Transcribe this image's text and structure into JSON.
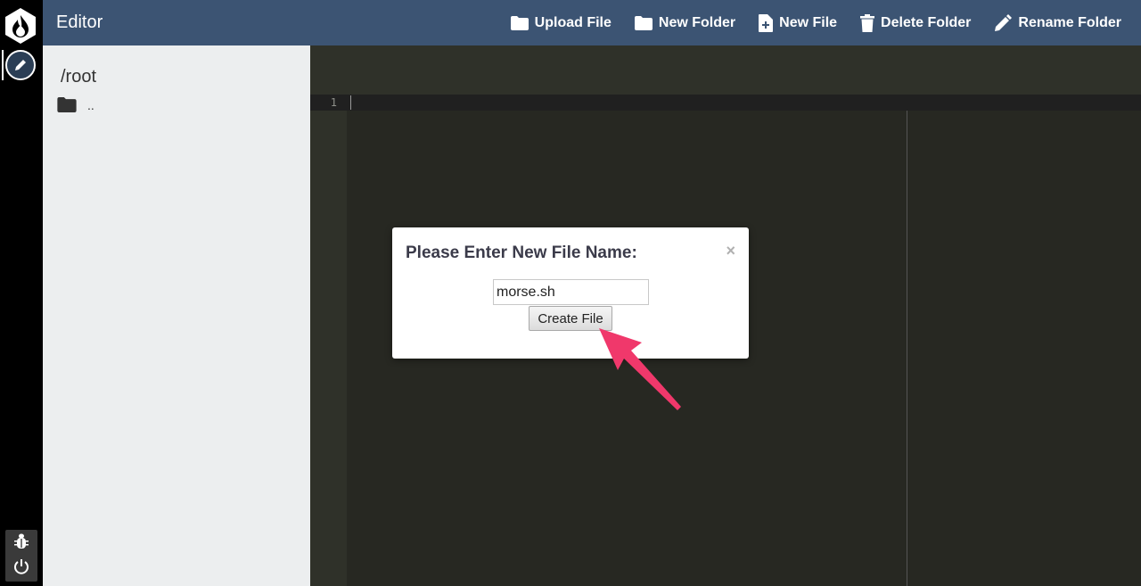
{
  "header": {
    "title": "Editor",
    "toolbar": [
      {
        "label": "Upload File",
        "icon": "folder-icon"
      },
      {
        "label": "New Folder",
        "icon": "folder-icon"
      },
      {
        "label": "New File",
        "icon": "file-plus-icon"
      },
      {
        "label": "Delete Folder",
        "icon": "trash-icon"
      },
      {
        "label": "Rename Folder",
        "icon": "pencil-icon"
      }
    ]
  },
  "sidebar": {
    "path": "/root",
    "items": [
      {
        "label": "..",
        "icon": "folder-icon"
      }
    ]
  },
  "editor": {
    "line_numbers": [
      "1"
    ]
  },
  "modal": {
    "title": "Please Enter New File Name:",
    "close": "×",
    "input_value": "morse.sh",
    "button_label": "Create File"
  },
  "colors": {
    "header": "#3c5473",
    "sidebar": "#eceeef",
    "editor_bg": "#272822",
    "annotation_arrow": "#f0386b"
  }
}
